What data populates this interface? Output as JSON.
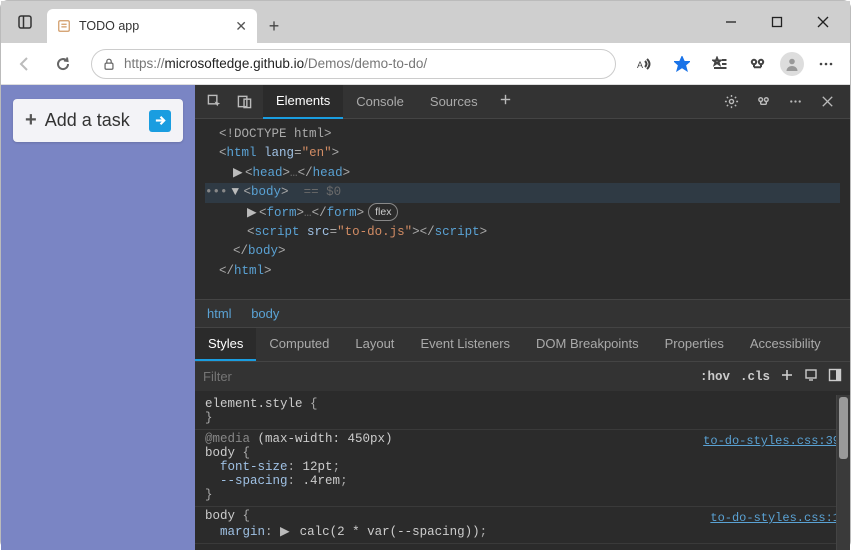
{
  "browser": {
    "tab_title": "TODO app",
    "url_host": "microsoftedge.github.io",
    "url_path": "/Demos/demo-to-do/",
    "url_scheme": "https://"
  },
  "page": {
    "add_task_label": "Add a task"
  },
  "devtools": {
    "tabs": {
      "elements": "Elements",
      "console": "Console",
      "sources": "Sources"
    },
    "dom": {
      "doctype": "<!DOCTYPE html>",
      "html_open": "html",
      "lang_attr": "lang",
      "lang_val": "\"en\"",
      "head": "head",
      "body": "body",
      "body_hint": "== $0",
      "form": "form",
      "form_pill": "flex",
      "script": "script",
      "script_src_attr": "src",
      "script_src_val": "\"to-do.js\""
    },
    "crumbs": {
      "c1": "html",
      "c2": "body"
    },
    "style_tabs": {
      "styles": "Styles",
      "computed": "Computed",
      "layout": "Layout",
      "ev": "Event Listeners",
      "dom": "DOM Breakpoints",
      "props": "Properties",
      "acc": "Accessibility"
    },
    "filter_placeholder": "Filter",
    "hov": ":hov",
    "cls": ".cls",
    "styles": {
      "s0_sel": "element.style",
      "s1_media_kw": "@media",
      "s1_media_q": "(max-width: 450px)",
      "s1_sel": "body",
      "s1_p1n": "font-size",
      "s1_p1v": "12pt",
      "s1_p2n": "--spacing",
      "s1_p2v": ".4rem",
      "s1_src": "to-do-styles.css:39",
      "s2_sel": "body",
      "s2_p1n": "margin",
      "s2_p1v": "calc(2 * var(--spacing))",
      "s2_src": "to-do-styles.css:1"
    }
  }
}
